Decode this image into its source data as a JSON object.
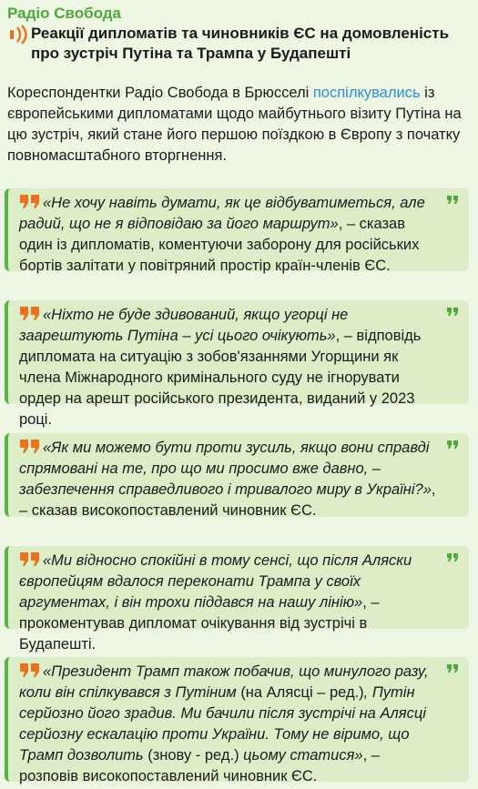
{
  "channel": {
    "name": "Радіо Свобода"
  },
  "headline": {
    "icon": "speaker-icon",
    "text": "Реакції дипломатів та чиновників ЄС на домовленість про зустріч Путіна та Трампа у Будапешті"
  },
  "intro": {
    "before": "Кореспондентки Радіо Свобода в Брюсселі ",
    "link": "поспілкувались",
    "after": " із європейськими дипломатами щодо майбутнього візиту Путіна на цю зустріч, який стане його першою поїздкою в Європу з початку повномасштабного вторгнення."
  },
  "colors": {
    "accent": "#4fa83d",
    "quote_bg": "#dcedc8",
    "quote_bar": "#5bb247",
    "quote_icon": "#e8731c",
    "link": "#2f8fd6"
  },
  "quotes": [
    {
      "parts": [
        {
          "t": "«Не хочу навіть думати, як це відбуватиметься, але радий, що не я відповідаю за його маршрут»",
          "i": true
        },
        {
          "t": ", – сказав один із дипломатів, коментуючи заборону для російських бортів залітати у повітряний простір країн-членів ЄС.",
          "i": false
        }
      ]
    },
    {
      "parts": [
        {
          "t": "«Ніхто не буде здивований, якщо угорці не заарештують Путіна – усі цього очікують»",
          "i": true
        },
        {
          "t": ", – відповідь дипломата на ситуацію з зобов'язаннями Угорщини як члена Міжнародного кримінального суду не ігнорувати ордер на арешт російського президента, виданий у 2023 році.",
          "i": false
        }
      ]
    },
    {
      "parts": [
        {
          "t": "«Як ми можемо бути проти зусиль, якщо вони справді спрямовані на те, про що ми просимо вже давно, – забезпечення справедливого і тривалого миру в Україні?»",
          "i": true
        },
        {
          "t": ", – сказав високопоставлений чиновник ЄС.",
          "i": false
        }
      ]
    },
    {
      "parts": [
        {
          "t": "«Ми відносно спокійні в тому сенсі, що після Аляски європейцям вдалося переконати Трампа у своїх аргументах, і він трохи піддався на нашу лінію»",
          "i": true
        },
        {
          "t": ", – прокоментував дипломат очікування від зустрічі в Будапешті.",
          "i": false
        }
      ]
    },
    {
      "parts": [
        {
          "t": "«Президент Трамп також побачив, що минулого разу, коли він спілкувався з Путіним ",
          "i": true
        },
        {
          "t": "(на Алясці – ред.)",
          "i": false
        },
        {
          "t": ", Путін серйозно його зрадив. Ми бачили після зустрічі на Алясці серйозну ескалацію проти України. Тому не віримо, що Трамп дозволить ",
          "i": true
        },
        {
          "t": "(знову - ред.)",
          "i": false
        },
        {
          "t": " цьому статися»",
          "i": true
        },
        {
          "t": ", – розповів високопоставлений чиновник ЄС.",
          "i": false
        }
      ]
    }
  ]
}
